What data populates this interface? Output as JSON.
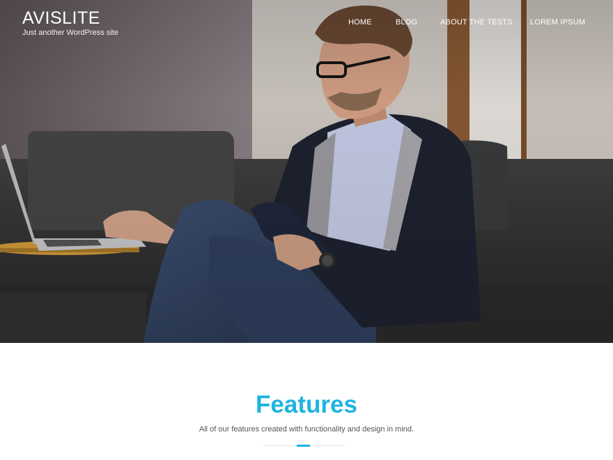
{
  "site": {
    "title": "AVISLITE",
    "tagline": "Just another WordPress site"
  },
  "nav": {
    "items": [
      {
        "label": "HOME"
      },
      {
        "label": "BLOG"
      },
      {
        "label": "ABOUT THE TESTS"
      },
      {
        "label": "LOREM IPSUM"
      }
    ]
  },
  "hero": {
    "image": "man-with-laptop-on-sofa"
  },
  "features": {
    "title": "Features",
    "subtitle": "All of our features created with functionality and design in mind."
  },
  "colors": {
    "accent": "#1eb4e0",
    "nav_text": "#ffffff",
    "body_text": "#555555"
  }
}
